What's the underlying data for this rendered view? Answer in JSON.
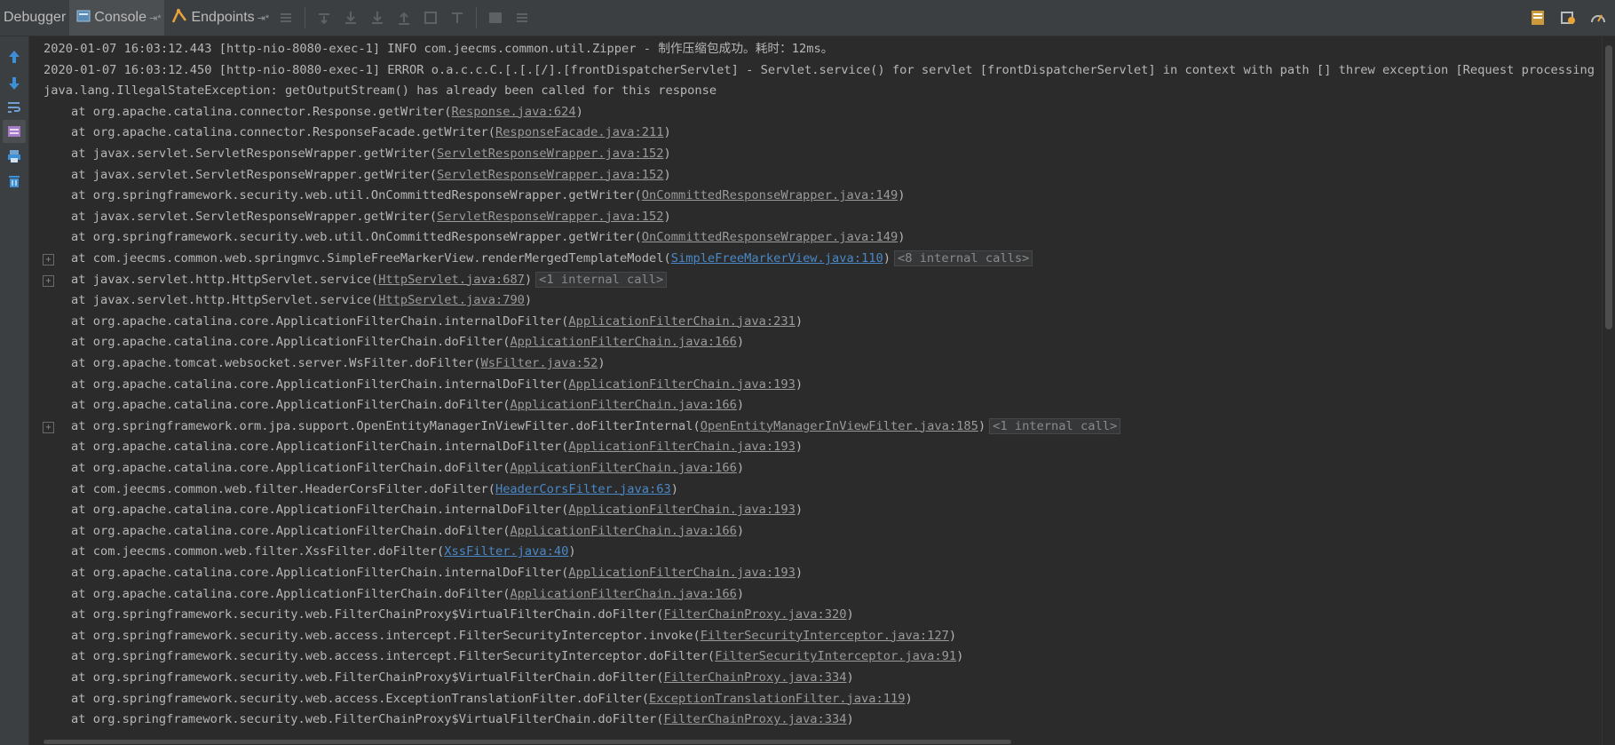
{
  "toolbar": {
    "tabs": [
      {
        "label": "Debugger"
      },
      {
        "label": "Console",
        "pin": "⇥*"
      },
      {
        "label": "Endpoints",
        "pin": "⇥*"
      }
    ]
  },
  "console": {
    "lines": [
      {
        "type": "log",
        "text": "2020-01-07 16:03:12.443 [http-nio-8080-exec-1] INFO  com.jeecms.common.util.Zipper - 制作压缩包成功。耗时：12ms。"
      },
      {
        "type": "log",
        "text": "2020-01-07 16:03:12.450 [http-nio-8080-exec-1] ERROR o.a.c.c.C.[.[.[/].[frontDispatcherServlet] - Servlet.service() for servlet [frontDispatcherServlet] in context with path [] threw exception [Request processing failed;"
      },
      {
        "type": "log",
        "text": "java.lang.IllegalStateException: getOutputStream() has already been called for this response"
      },
      {
        "type": "frame",
        "method": "at org.apache.catalina.connector.Response.getWriter(",
        "link": "Response.java:624",
        "close": ")"
      },
      {
        "type": "frame",
        "method": "at org.apache.catalina.connector.ResponseFacade.getWriter(",
        "link": "ResponseFacade.java:211",
        "close": ")"
      },
      {
        "type": "frame",
        "method": "at javax.servlet.ServletResponseWrapper.getWriter(",
        "link": "ServletResponseWrapper.java:152",
        "close": ")"
      },
      {
        "type": "frame",
        "method": "at javax.servlet.ServletResponseWrapper.getWriter(",
        "link": "ServletResponseWrapper.java:152",
        "close": ")"
      },
      {
        "type": "frame",
        "method": "at org.springframework.security.web.util.OnCommittedResponseWrapper.getWriter(",
        "link": "OnCommittedResponseWrapper.java:149",
        "close": ")"
      },
      {
        "type": "frame",
        "method": "at javax.servlet.ServletResponseWrapper.getWriter(",
        "link": "ServletResponseWrapper.java:152",
        "close": ")"
      },
      {
        "type": "frame",
        "method": "at org.springframework.security.web.util.OnCommittedResponseWrapper.getWriter(",
        "link": "OnCommittedResponseWrapper.java:149",
        "close": ")"
      },
      {
        "type": "frame",
        "method": "at com.jeecms.common.web.springmvc.SimpleFreeMarkerView.renderMergedTemplateModel(",
        "link": "SimpleFreeMarkerView.java:110",
        "close": ")",
        "blue": true,
        "fold": "<8 internal calls>",
        "expander": "+"
      },
      {
        "type": "frame",
        "method": "at javax.servlet.http.HttpServlet.service(",
        "link": "HttpServlet.java:687",
        "close": ")",
        "fold": "<1 internal call>",
        "expander": "+"
      },
      {
        "type": "frame",
        "method": "at javax.servlet.http.HttpServlet.service(",
        "link": "HttpServlet.java:790",
        "close": ")"
      },
      {
        "type": "frame",
        "method": "at org.apache.catalina.core.ApplicationFilterChain.internalDoFilter(",
        "link": "ApplicationFilterChain.java:231",
        "close": ")"
      },
      {
        "type": "frame",
        "method": "at org.apache.catalina.core.ApplicationFilterChain.doFilter(",
        "link": "ApplicationFilterChain.java:166",
        "close": ")"
      },
      {
        "type": "frame",
        "method": "at org.apache.tomcat.websocket.server.WsFilter.doFilter(",
        "link": "WsFilter.java:52",
        "close": ")"
      },
      {
        "type": "frame",
        "method": "at org.apache.catalina.core.ApplicationFilterChain.internalDoFilter(",
        "link": "ApplicationFilterChain.java:193",
        "close": ")"
      },
      {
        "type": "frame",
        "method": "at org.apache.catalina.core.ApplicationFilterChain.doFilter(",
        "link": "ApplicationFilterChain.java:166",
        "close": ")"
      },
      {
        "type": "frame",
        "method": "at org.springframework.orm.jpa.support.OpenEntityManagerInViewFilter.doFilterInternal(",
        "link": "OpenEntityManagerInViewFilter.java:185",
        "close": ")",
        "fold": "<1 internal call>",
        "expander": "+"
      },
      {
        "type": "frame",
        "method": "at org.apache.catalina.core.ApplicationFilterChain.internalDoFilter(",
        "link": "ApplicationFilterChain.java:193",
        "close": ")"
      },
      {
        "type": "frame",
        "method": "at org.apache.catalina.core.ApplicationFilterChain.doFilter(",
        "link": "ApplicationFilterChain.java:166",
        "close": ")"
      },
      {
        "type": "frame",
        "method": "at com.jeecms.common.web.filter.HeaderCorsFilter.doFilter(",
        "link": "HeaderCorsFilter.java:63",
        "close": ")",
        "blue": true
      },
      {
        "type": "frame",
        "method": "at org.apache.catalina.core.ApplicationFilterChain.internalDoFilter(",
        "link": "ApplicationFilterChain.java:193",
        "close": ")"
      },
      {
        "type": "frame",
        "method": "at org.apache.catalina.core.ApplicationFilterChain.doFilter(",
        "link": "ApplicationFilterChain.java:166",
        "close": ")"
      },
      {
        "type": "frame",
        "method": "at com.jeecms.common.web.filter.XssFilter.doFilter(",
        "link": "XssFilter.java:40",
        "close": ")",
        "blue": true
      },
      {
        "type": "frame",
        "method": "at org.apache.catalina.core.ApplicationFilterChain.internalDoFilter(",
        "link": "ApplicationFilterChain.java:193",
        "close": ")"
      },
      {
        "type": "frame",
        "method": "at org.apache.catalina.core.ApplicationFilterChain.doFilter(",
        "link": "ApplicationFilterChain.java:166",
        "close": ")"
      },
      {
        "type": "frame",
        "method": "at org.springframework.security.web.FilterChainProxy$VirtualFilterChain.doFilter(",
        "link": "FilterChainProxy.java:320",
        "close": ")"
      },
      {
        "type": "frame",
        "method": "at org.springframework.security.web.access.intercept.FilterSecurityInterceptor.invoke(",
        "link": "FilterSecurityInterceptor.java:127",
        "close": ")"
      },
      {
        "type": "frame",
        "method": "at org.springframework.security.web.access.intercept.FilterSecurityInterceptor.doFilter(",
        "link": "FilterSecurityInterceptor.java:91",
        "close": ")"
      },
      {
        "type": "frame",
        "method": "at org.springframework.security.web.FilterChainProxy$VirtualFilterChain.doFilter(",
        "link": "FilterChainProxy.java:334",
        "close": ")"
      },
      {
        "type": "frame",
        "method": "at org.springframework.security.web.access.ExceptionTranslationFilter.doFilter(",
        "link": "ExceptionTranslationFilter.java:119",
        "close": ")"
      },
      {
        "type": "frame",
        "method": "at org.springframework.security.web.FilterChainProxy$VirtualFilterChain.doFilter(",
        "link": "FilterChainProxy.java:334",
        "close": ")"
      }
    ]
  },
  "colors": {
    "background": "#2b2b2b",
    "panel": "#3c3f41",
    "text": "#bbbbbb",
    "link": "#9a9a9a",
    "link_blue": "#4a88c7"
  }
}
